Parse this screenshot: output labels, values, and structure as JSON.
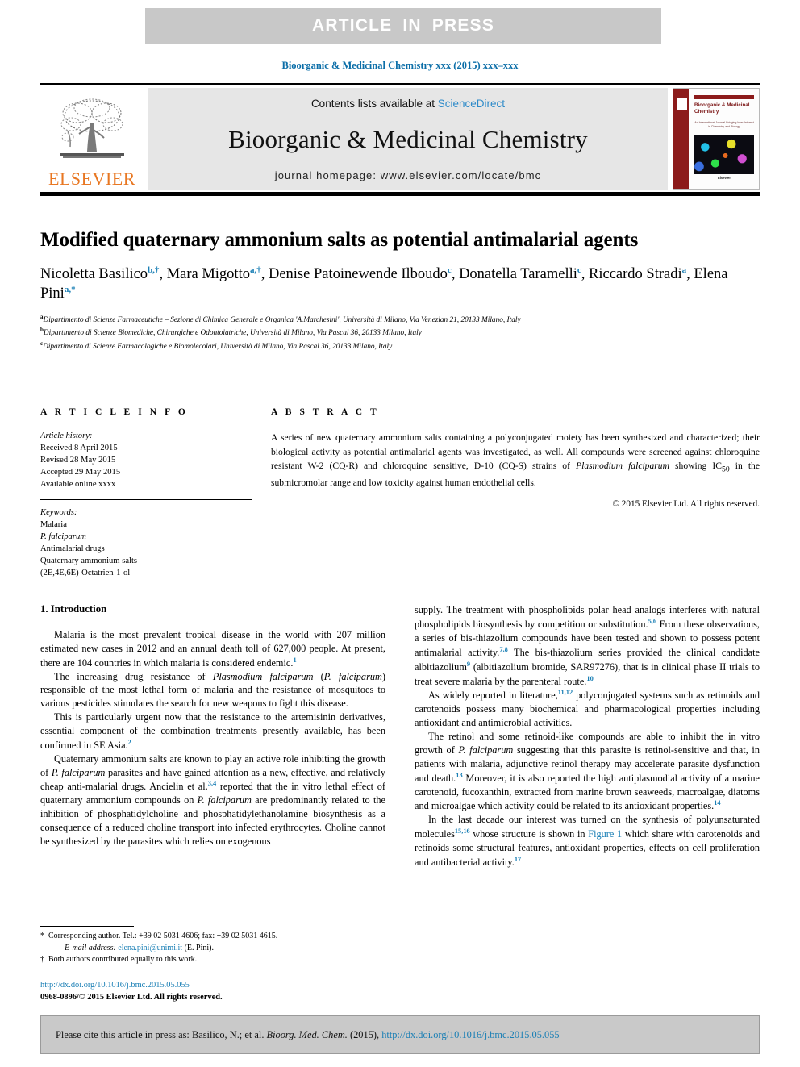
{
  "banner": {
    "text": "ARTICLE  IN  PRESS",
    "bg_color": "#c8c8c8",
    "text_color": "#ffffff"
  },
  "running_head": "Bioorganic & Medicinal Chemistry xxx (2015) xxx–xxx",
  "masthead": {
    "contents_prefix": "Contents lists available at ",
    "sciencedirect": "ScienceDirect",
    "journal_title": "Bioorganic & Medicinal Chemistry",
    "homepage": "journal homepage: www.elsevier.com/locate/bmc",
    "publisher_wordmark": "ELSEVIER",
    "publisher_color": "#e87722",
    "link_color": "#2e8bc9",
    "cover": {
      "title": "Bioorganic & Medicinal Chemistry",
      "subtitle": "An International Journal Bridging Inter-Interest in Chemistry and Biology",
      "footer_label": "Elsevier",
      "spine_color": "#8c1b1b"
    }
  },
  "article": {
    "title": "Modified quaternary ammonium salts as potential antimalarial agents",
    "authors": [
      {
        "name": "Nicoletta Basilico",
        "marks": "b,†"
      },
      {
        "name": "Mara Migotto",
        "marks": "a,†"
      },
      {
        "name": "Denise Patoinewende Ilboudo",
        "marks": "c"
      },
      {
        "name": "Donatella Taramelli",
        "marks": "c"
      },
      {
        "name": "Riccardo Stradi",
        "marks": "a"
      },
      {
        "name": "Elena Pini",
        "marks": "a,*"
      }
    ],
    "affiliations": [
      {
        "mark": "a",
        "text": "Dipartimento di Scienze Farmaceutiche – Sezione di Chimica Generale e Organica 'A.Marchesini', Università di Milano, Via Venezian 21, 20133 Milano, Italy"
      },
      {
        "mark": "b",
        "text": "Dipartimento di Scienze Biomediche, Chirurgiche e Odontoiatriche, Università di Milano, Via Pascal 36, 20133 Milano, Italy"
      },
      {
        "mark": "c",
        "text": "Dipartimento di Scienze Farmacologiche e Biomolecolari, Università di Milano, Via Pascal 36, 20133 Milano, Italy"
      }
    ]
  },
  "article_info": {
    "heading": "A R T I C L E   I N F O",
    "history_label": "Article history:",
    "history": [
      "Received 8 April 2015",
      "Revised 28 May 2015",
      "Accepted 29 May 2015",
      "Available online xxxx"
    ],
    "keywords_label": "Keywords:",
    "keywords": [
      "Malaria",
      "P. falciparum",
      "Antimalarial drugs",
      "Quaternary ammonium salts",
      "(2E,4E,6E)-Octatrien-1-ol"
    ]
  },
  "abstract": {
    "heading": "A B S T R A C T",
    "part1": "A series of new quaternary ammonium salts containing a polyconjugated moiety has been synthesized and characterized; their biological activity as potential antimalarial agents was investigated, as well. All compounds were screened against chloroquine resistant W-2 (CQ-R) and chloroquine sensitive, D-10 (CQ-S) strains of ",
    "italic_species": "Plasmodium falciparum",
    "part2": " showing IC",
    "sub": "50",
    "part3": " in the submicromolar range and low toxicity against human endothelial cells.",
    "copyright": "© 2015 Elsevier Ltd. All rights reserved."
  },
  "section": {
    "number_title": "1. Introduction"
  },
  "body_left": {
    "p1_a": "Malaria is the most prevalent tropical disease in the world with 207 million estimated new cases in 2012 and an annual death toll of 627,000 people. At present, there are 104 countries in which malaria is considered endemic.",
    "p1_ref": "1",
    "p2_a": "The increasing drug resistance of ",
    "p2_italic1": "Plasmodium falciparum",
    "p2_b": " (",
    "p2_italic2": "P. falciparum",
    "p2_c": ") responsible of the most lethal form of malaria and the resistance of mosquitoes to various pesticides stimulates the search for new weapons to fight this disease.",
    "p3_a": "This is particularly urgent now that the resistance to the artemisinin derivatives, essential component of the combination treatments presently available, has been confirmed in SE Asia.",
    "p3_ref": "2",
    "p4_a": "Quaternary ammonium salts are known to play an active role inhibiting the growth of ",
    "p4_italic1": "P. falciparum",
    "p4_b": " parasites and have gained attention as a new, effective, and relatively cheap anti-malarial drugs. Ancielin et al.",
    "p4_ref": "3,4",
    "p4_c": " reported that the in vitro lethal effect of quaternary ammonium compounds on ",
    "p4_italic2": "P. falciparum",
    "p4_d": " are predominantly related to the inhibition of phosphatidylcholine and phosphatidylethanolamine biosynthesis as a consequence of a reduced choline transport into infected erythrocytes. Choline cannot be synthesized by the parasites which relies on exogenous"
  },
  "body_right": {
    "p1_a": "supply. The treatment with phospholipids polar head analogs interferes with natural phospholipids biosynthesis by competition or substitution.",
    "p1_ref1": "5,6",
    "p1_b": " From these observations, a series of bis-thiazolium compounds have been tested and shown to possess potent antimalarial activity.",
    "p1_ref2": "7,8",
    "p1_c": " The bis-thiazolium series provided the clinical candidate albitiazolium",
    "p1_ref3": "9",
    "p1_d": " (albitiazolium bromide, SAR97276), that is in clinical phase II trials to treat severe malaria by the parenteral route.",
    "p1_ref4": "10",
    "p2_a": "As widely reported in literature,",
    "p2_ref": "11,12",
    "p2_b": " polyconjugated systems such as retinoids and carotenoids possess many biochemical and pharmacological properties including antioxidant and antimicrobial activities.",
    "p3_a": "The retinol and some retinoid-like compounds are able to inhibit the in vitro growth of ",
    "p3_italic": "P. falciparum",
    "p3_b": " suggesting that this parasite is retinol-sensitive and that, in patients with malaria, adjunctive retinol therapy may accelerate parasite dysfunction and death.",
    "p3_ref1": "13",
    "p3_c": " Moreover, it is also reported the high antiplasmodial activity of a marine carotenoid, fucoxanthin, extracted from marine brown seaweeds, macroalgae, diatoms and microalgae which activity could be related to its antioxidant properties.",
    "p3_ref2": "14",
    "p4_a": "In the last decade our interest was turned on the synthesis of polyunsaturated molecules",
    "p4_ref1": "15,16",
    "p4_b": " whose structure is shown in ",
    "p4_figlink": "Figure 1",
    "p4_c": " which share with carotenoids and retinoids some structural features, antioxidant properties, effects on cell proliferation and antibacterial activity.",
    "p4_ref2": "17"
  },
  "footnotes": {
    "corresponding_mark": "*",
    "corresponding": "Corresponding author. Tel.: +39 02 5031 4606; fax: +39 02 5031 4615.",
    "email_label": "E-mail address:",
    "email": "elena.pini@unimi.it",
    "email_owner": "(E. Pini).",
    "dagger_mark": "†",
    "equal_contrib": "Both authors contributed equally to this work.",
    "doi_url": "http://dx.doi.org/10.1016/j.bmc.2015.05.055",
    "issn_line": "0968-0896/© 2015 Elsevier Ltd. All rights reserved."
  },
  "cite_box": {
    "prefix": "Please cite this article in press as: Basilico, N.; et al. ",
    "journal_italic": "Bioorg. Med. Chem.",
    "year": " (2015), ",
    "doi": "http://dx.doi.org/10.1016/j.bmc.2015.05.055",
    "bg_color": "#c9c9c9"
  },
  "link_color": "#1a7fb5"
}
